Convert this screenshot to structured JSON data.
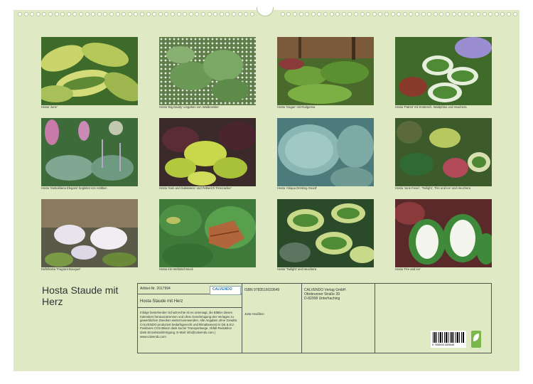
{
  "captions": [
    "Hosta 'June'",
    "Hosta 'Big Daddy' umgeben von Waldmeister",
    "Hosta 'Gagae' mit Rodgersia",
    "Hosta 'Patriot' mit Knöterich, Waldphlox und Heuchera",
    "Hosta 'Sieboldiana Elegans' begleitet von Astilben",
    "Hosta 'Sum and Substance' und Felberich 'Firecracker'",
    "Hosta 'Abiqua Drinking Gourd'",
    "Hosta 'June Fever', 'Twilight', 'Fire and Ice' und Heuchera",
    "Duftshosta 'Fragrant Bouquet'",
    "Hosta mit Herbstschmuck",
    "Hosta 'Twilight' und Heuchera",
    "Hosta 'Fire and Ice'"
  ],
  "calendar_title": "Hosta Staude mit Herz",
  "info": {
    "article_no": "Artikel-Nr. 2017994",
    "logo_text": "CALVENDO",
    "product_title": "Hosta Staude mit Herz",
    "legal_text": "Infolge bestehender Schutzrechte ist es untersagt, die Blätter dieses Kalenders herauszutrennen und ohne Genehmigung des Verlages zu gewerblichen Zwecken weiterzuverwenden. Alle Angaben ohne Gewähr. CALVENDO produziert bedarfsgerecht und klimabewusst in DE & EU. Positivere CO2-Bilanz dank kurzer Transportwege. Abfall-Reduktion dank Einzelstückfertigung. E-Mail: info@calvendo.com | www.calvendo.com",
    "isbn": "ISBN 9783516033649",
    "author": "Jutta Heußlein",
    "publisher_name": "CALVENDO Verlag GmbH",
    "publisher_street": "Ottobrunner Straße 39",
    "publisher_city": "D-82008 Unterhaching",
    "barcode_number": "9 783516 033649"
  },
  "colors": {
    "page_background": "#dfe9c4",
    "border": "#555555"
  }
}
